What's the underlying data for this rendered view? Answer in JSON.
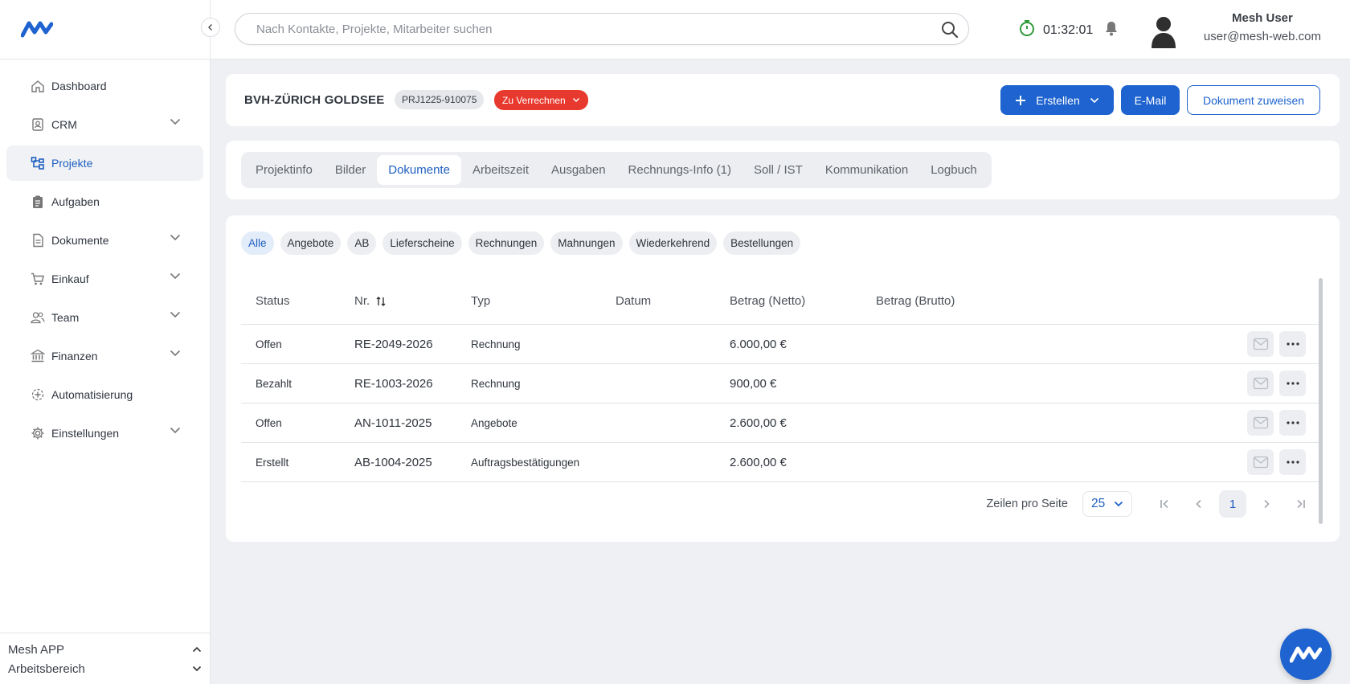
{
  "sidebar": {
    "items": [
      {
        "label": "Dashboard",
        "icon": "home-icon",
        "active": false,
        "expandable": false
      },
      {
        "label": "CRM",
        "icon": "contacts-icon",
        "active": false,
        "expandable": true
      },
      {
        "label": "Projekte",
        "icon": "projects-icon",
        "active": true,
        "expandable": false
      },
      {
        "label": "Aufgaben",
        "icon": "clipboard-icon",
        "active": false,
        "expandable": false
      },
      {
        "label": "Dokumente",
        "icon": "document-icon",
        "active": false,
        "expandable": true
      },
      {
        "label": "Einkauf",
        "icon": "cart-icon",
        "active": false,
        "expandable": true
      },
      {
        "label": "Team",
        "icon": "team-icon",
        "active": false,
        "expandable": true
      },
      {
        "label": "Finanzen",
        "icon": "bank-icon",
        "active": false,
        "expandable": true
      },
      {
        "label": "Automatisierung",
        "icon": "automation-icon",
        "active": false,
        "expandable": false
      },
      {
        "label": "Einstellungen",
        "icon": "gear-icon",
        "active": false,
        "expandable": true
      }
    ],
    "bottom": {
      "app": "Mesh APP",
      "workspace": "Arbeitsbereich"
    }
  },
  "topbar": {
    "search_placeholder": "Nach Kontakte, Projekte, Mitarbeiter suchen",
    "timer": "01:32:01",
    "user_name": "Mesh User",
    "user_email": "user@mesh-web.com"
  },
  "project": {
    "title": "BVH-ZÜRICH GOLDSEE",
    "code": "PRJ1225-910075",
    "status": "Zu Verrechnen",
    "buttons": {
      "create": "Erstellen",
      "mail": "E-Mail",
      "assign": "Dokument zuweisen"
    }
  },
  "tabs": [
    {
      "label": "Projektinfo",
      "active": false
    },
    {
      "label": "Bilder",
      "active": false
    },
    {
      "label": "Dokumente",
      "active": true
    },
    {
      "label": "Arbeitszeit",
      "active": false
    },
    {
      "label": "Ausgaben",
      "active": false
    },
    {
      "label": "Rechnungs-Info (1)",
      "active": false
    },
    {
      "label": "Soll / IST",
      "active": false
    },
    {
      "label": "Kommunikation",
      "active": false
    },
    {
      "label": "Logbuch",
      "active": false
    }
  ],
  "filters": [
    {
      "label": "Alle",
      "active": true
    },
    {
      "label": "Angebote",
      "active": false
    },
    {
      "label": "AB",
      "active": false
    },
    {
      "label": "Lieferscheine",
      "active": false
    },
    {
      "label": "Rechnungen",
      "active": false
    },
    {
      "label": "Mahnungen",
      "active": false
    },
    {
      "label": "Wiederkehrend",
      "active": false
    },
    {
      "label": "Bestellungen",
      "active": false
    }
  ],
  "table": {
    "headers": {
      "status": "Status",
      "nr": "Nr.",
      "typ": "Typ",
      "datum": "Datum",
      "netto": "Betrag (Netto)",
      "brutto": "Betrag (Brutto)"
    },
    "rows": [
      {
        "status": "Offen",
        "nr": "RE-2049-2026",
        "typ": "Rechnung",
        "datum": "",
        "netto": "6.000,00 €",
        "brutto": ""
      },
      {
        "status": "Bezahlt",
        "nr": "RE-1003-2026",
        "typ": "Rechnung",
        "datum": "",
        "netto": "900,00 €",
        "brutto": ""
      },
      {
        "status": "Offen",
        "nr": "AN-1011-2025",
        "typ": "Angebote",
        "datum": "",
        "netto": "2.600,00 €",
        "brutto": ""
      },
      {
        "status": "Erstellt",
        "nr": "AB-1004-2025",
        "typ": "Auftragsbestätigungen",
        "datum": "",
        "netto": "2.600,00 €",
        "brutto": ""
      }
    ]
  },
  "pagination": {
    "rows_label": "Zeilen pro Seite",
    "rows_value": "25",
    "current_page": "1"
  },
  "colors": {
    "accent": "#1e63cf",
    "status_red": "#e8392e",
    "timer_green": "#2e9b3a"
  }
}
